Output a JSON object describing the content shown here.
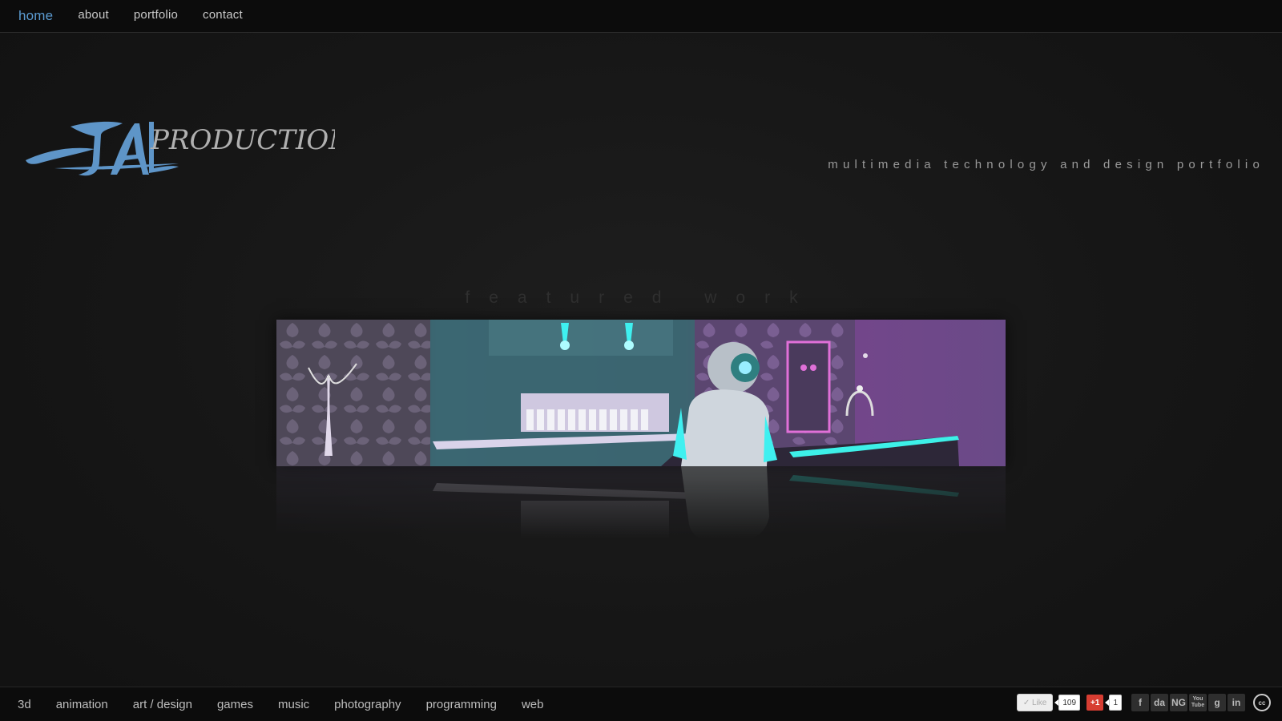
{
  "nav": {
    "items": [
      {
        "label": "home",
        "active": true
      },
      {
        "label": "about"
      },
      {
        "label": "portfolio"
      },
      {
        "label": "contact"
      }
    ]
  },
  "logo": {
    "mark": "JAL",
    "text": "PRODUCTIONS"
  },
  "tagline": "multimedia technology and design portfolio",
  "featured": {
    "title": "featured work"
  },
  "categories": [
    "3d",
    "animation",
    "art / design",
    "games",
    "music",
    "photography",
    "programming",
    "web"
  ],
  "social": {
    "like_label": "Like",
    "like_count": "109",
    "gplus_label": "+1",
    "gplus_count": "1",
    "icons": [
      "facebook-icon",
      "deviantart-icon",
      "newgrounds-icon",
      "youtube-icon",
      "google-icon",
      "linkedin-icon"
    ],
    "icon_glyphs": {
      "facebook": "f",
      "deviantart": "da",
      "newgrounds": "NG",
      "youtube": "You Tube",
      "google": "g",
      "linkedin": "in",
      "cc": "cc"
    }
  },
  "colors": {
    "accent": "#5b9bd1",
    "background": "#161616",
    "bar": "#0c0c0c",
    "gplus": "#d73d32"
  }
}
